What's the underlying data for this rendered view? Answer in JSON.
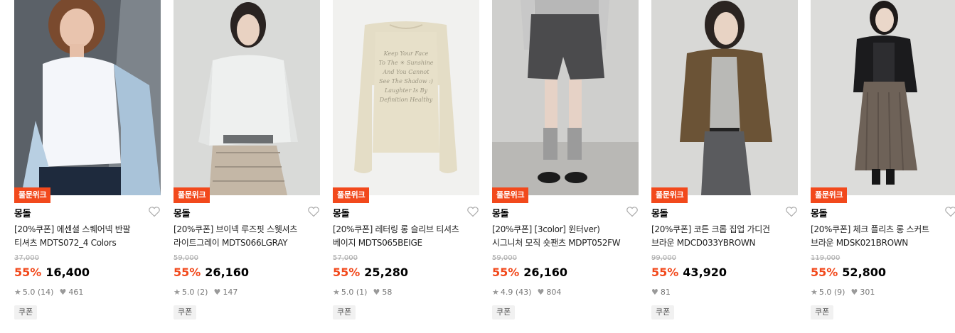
{
  "products": [
    {
      "badge": "풀문위크",
      "brand": "몽돌",
      "title_line1": "[20%쿠폰] 에센셜 스퀘어넥 반팔",
      "title_line2": "티셔츠 MDTS072_4 Colors",
      "original_price": "37,000",
      "discount": "55%",
      "price": "16,400",
      "rating": "5.0",
      "reviews": "(14)",
      "likes": "461",
      "coupon": "쿠폰"
    },
    {
      "badge": "풀문위크",
      "brand": "몽돌",
      "title_line1": "[20%쿠폰] 브이넥 루즈핏 스웻셔츠",
      "title_line2": "라이트그레이 MDTS066LGRAY",
      "original_price": "59,000",
      "discount": "55%",
      "price": "26,160",
      "rating": "5.0",
      "reviews": "(2)",
      "likes": "147",
      "coupon": "쿠폰"
    },
    {
      "badge": "풀문위크",
      "brand": "몽돌",
      "title_line1": "[20%쿠폰] 레터링 롱 슬리브 티셔츠",
      "title_line2": "베이지 MDTS065BEIGE",
      "original_price": "57,000",
      "discount": "55%",
      "price": "25,280",
      "rating": "5.0",
      "reviews": "(1)",
      "likes": "58",
      "coupon": "쿠폰",
      "print_text": [
        "Keep Your Face",
        "To The ☀ Sunshine",
        "And You Cannot",
        "See The Shadow :)",
        "Laughter Is By",
        "Definition Healthy"
      ]
    },
    {
      "badge": "풀문위크",
      "brand": "몽돌",
      "title_line1": "[20%쿠폰] [3color] 윈터ver)",
      "title_line2": "시그니처 모직 숏팬츠 MDPT052FW",
      "original_price": "59,000",
      "discount": "55%",
      "price": "26,160",
      "rating": "4.9",
      "reviews": "(43)",
      "likes": "804",
      "coupon": "쿠폰"
    },
    {
      "badge": "풀문위크",
      "brand": "몽돌",
      "title_line1": "[20%쿠폰] 코튼 크롭 집업 가디건",
      "title_line2": "브라운 MDCD033YBROWN",
      "original_price": "99,000",
      "discount": "55%",
      "price": "43,920",
      "rating": null,
      "reviews": null,
      "likes": "81",
      "coupon": "쿠폰"
    },
    {
      "badge": "풀문위크",
      "brand": "몽돌",
      "title_line1": "[20%쿠폰] 체크 플리츠 롱 스커트",
      "title_line2": "브라운 MDSK021BROWN",
      "original_price": "119,000",
      "discount": "55%",
      "price": "52,800",
      "rating": "5.0",
      "reviews": "(9)",
      "likes": "301",
      "coupon": "쿠폰"
    }
  ],
  "icons": {
    "wishlist": "heart-outline-icon",
    "rating": "star-icon",
    "likes": "heart-filled-icon"
  },
  "colors": {
    "accent": "#f2491c",
    "muted": "#999999",
    "strike": "#aaaaaa"
  }
}
